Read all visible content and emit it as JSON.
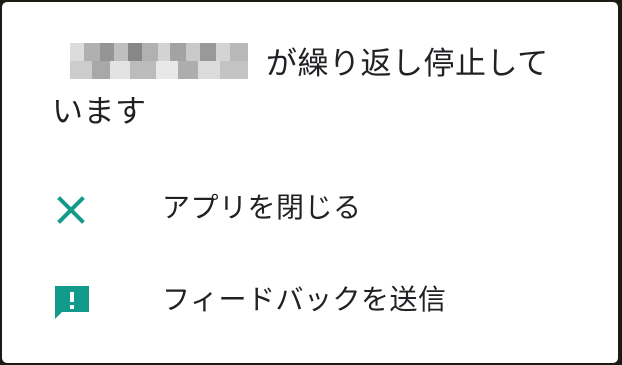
{
  "dialog": {
    "app_name": "",
    "title_suffix": "が繰り返し停止しています"
  },
  "actions": [
    {
      "label": "アプリを閉じる",
      "icon": "close-icon"
    },
    {
      "label": "フィードバックを送信",
      "icon": "feedback-icon"
    }
  ],
  "colors": {
    "accent": "#129b8a",
    "text": "#202124",
    "background": "#ffffff"
  }
}
